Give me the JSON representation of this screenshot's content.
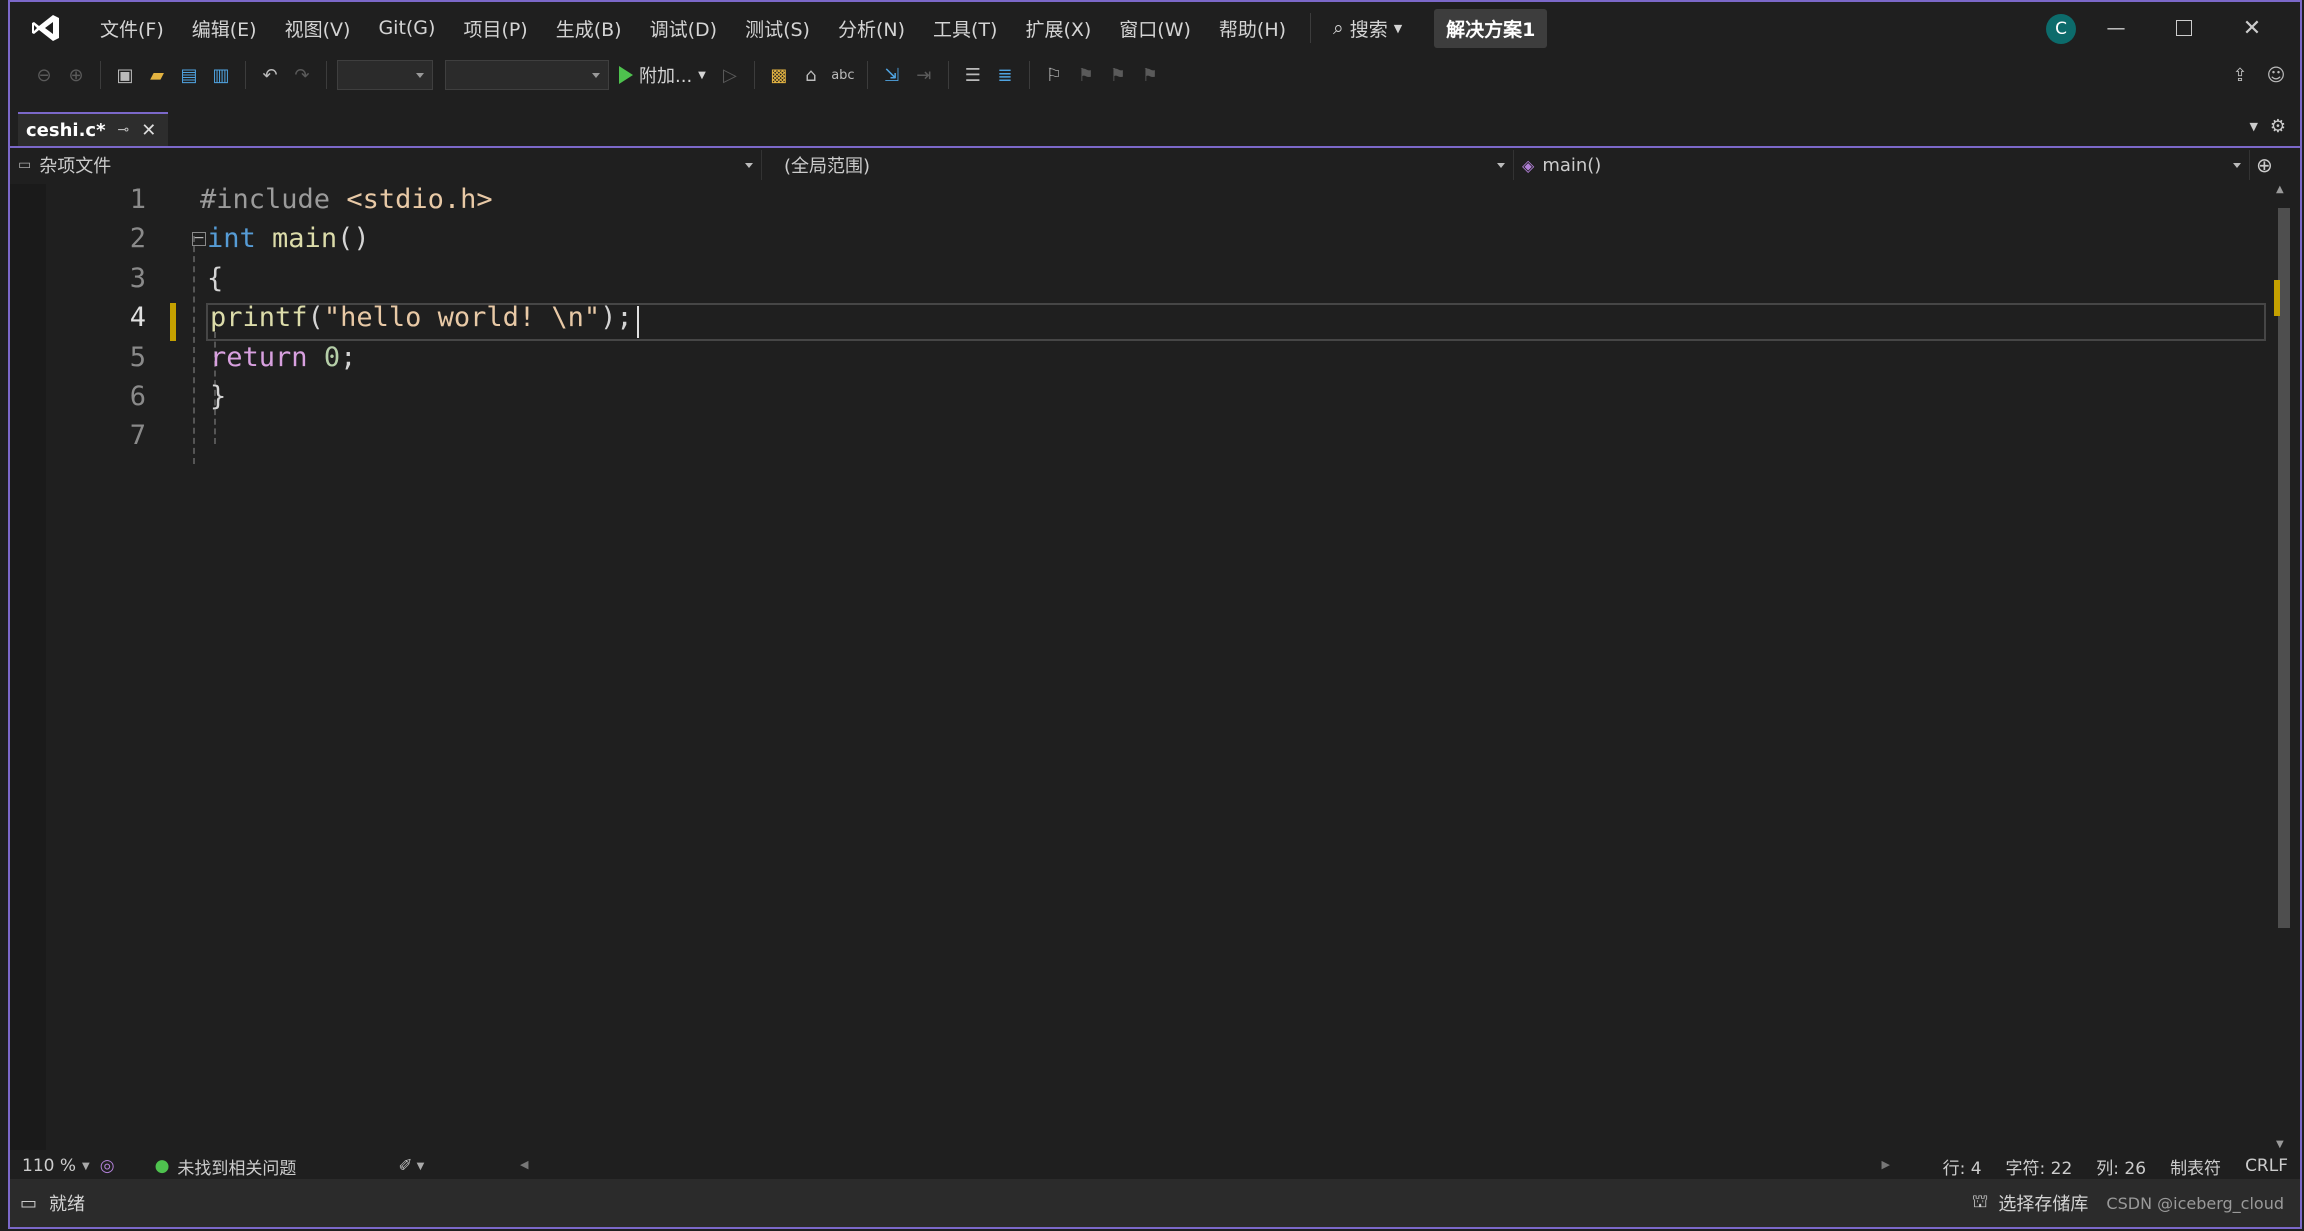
{
  "menu": {
    "items": [
      "文件(F)",
      "编辑(E)",
      "视图(V)",
      "Git(G)",
      "项目(P)",
      "生成(B)",
      "调试(D)",
      "测试(S)",
      "分析(N)",
      "工具(T)",
      "扩展(X)",
      "窗口(W)",
      "帮助(H)"
    ],
    "search_label": "搜索",
    "solution_name": "解决方案1",
    "avatar_letter": "C"
  },
  "toolbar": {
    "attach_label": "附加..."
  },
  "tab": {
    "filename": "ceshi.c*"
  },
  "navbar": {
    "project": "杂项文件",
    "scope": "(全局范围)",
    "member": "main()"
  },
  "editor": {
    "line_numbers": [
      "1",
      "2",
      "3",
      "4",
      "5",
      "6",
      "7"
    ],
    "current_line": "4",
    "lines": [
      "#include <stdio.h>",
      "int main()",
      "{",
      "    printf(\"hello world! \\n\");",
      "    return 0;",
      "}",
      ""
    ]
  },
  "editor_status": {
    "zoom": "110 %",
    "issues": "未找到相关问题",
    "line": "行: 4",
    "char": "字符: 22",
    "col": "列: 26",
    "indent": "制表符",
    "eol": "CRLF"
  },
  "statusbar": {
    "state": "就绪",
    "repo": "选择存储库",
    "watermark": "CSDN @iceberg_cloud"
  },
  "colors": {
    "accent": "#7b68c9",
    "keyword": "#569cd6",
    "control_keyword": "#d8a0df",
    "string": "#e8c9a6",
    "function": "#dcdcaa",
    "number": "#b5cea8"
  }
}
